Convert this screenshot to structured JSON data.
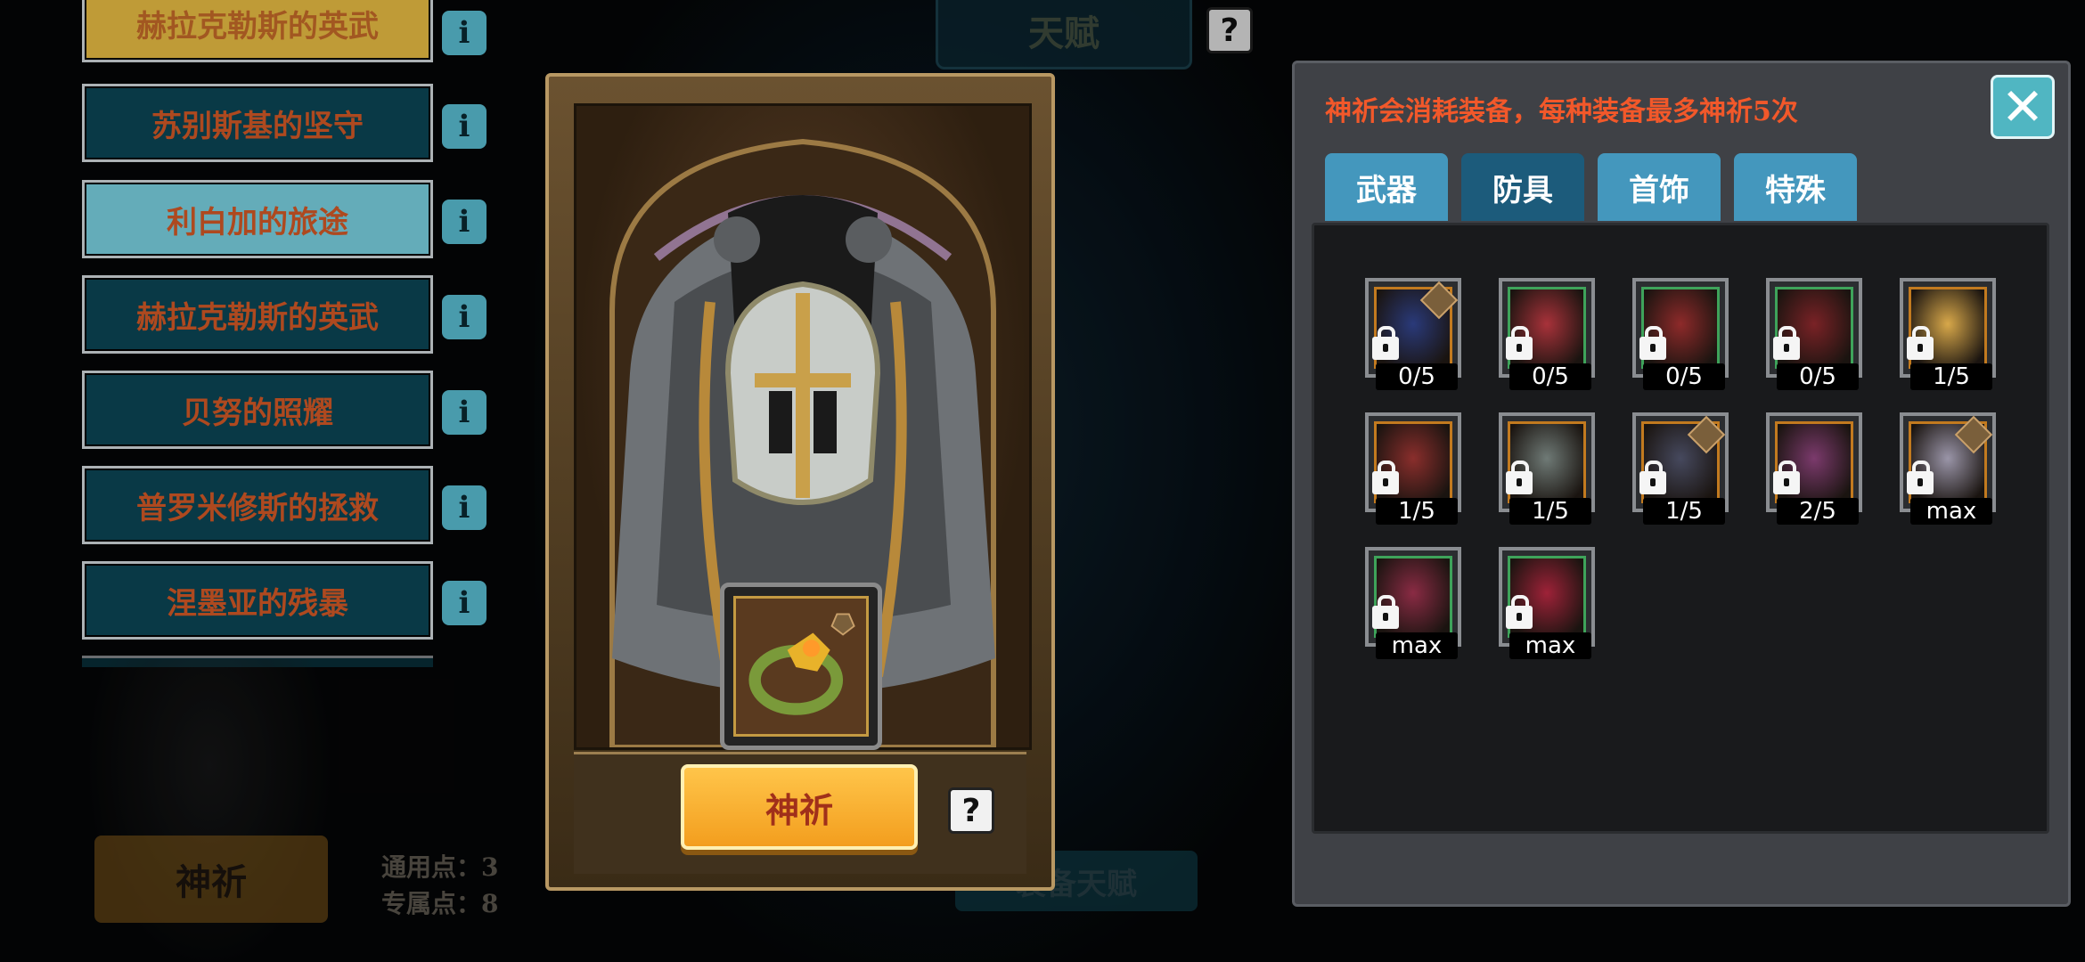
{
  "top_tab": {
    "label": "天赋"
  },
  "left_list": {
    "items": [
      {
        "label": "赫拉克勒斯的英武",
        "state": "gold-partial"
      },
      {
        "label": "苏别斯基的坚守",
        "state": "normal"
      },
      {
        "label": "利白加的旅途",
        "state": "selected"
      },
      {
        "label": "赫拉克勒斯的英武",
        "state": "normal"
      },
      {
        "label": "贝努的照耀",
        "state": "normal"
      },
      {
        "label": "普罗米修斯的拯救",
        "state": "normal"
      },
      {
        "label": "涅墨亚的残暴",
        "state": "normal"
      }
    ],
    "info_icon": "i"
  },
  "faded_bottom": {
    "pray_label": "神祈",
    "general_points": "通用点：3",
    "exclusive_points": "专属点：8",
    "talent_button": "装备天赋"
  },
  "card": {
    "pray_button": "神祈",
    "help_icon": "?"
  },
  "panel": {
    "notice": "神祈会消耗装备，每种装备最多神祈5次",
    "close_icon": "✕",
    "tabs": [
      {
        "label": "武器",
        "active": false
      },
      {
        "label": "防具",
        "active": true
      },
      {
        "label": "首饰",
        "active": false
      },
      {
        "label": "特殊",
        "active": false
      }
    ],
    "items": [
      {
        "count": "0/5",
        "frame": "orange",
        "tone": "#2a3a7a",
        "has_corner": true
      },
      {
        "count": "0/5",
        "frame": "green",
        "tone": "#a8323a",
        "has_corner": false
      },
      {
        "count": "0/5",
        "frame": "green",
        "tone": "#8e2a2a",
        "has_corner": false
      },
      {
        "count": "0/5",
        "frame": "green",
        "tone": "#7a2226",
        "has_corner": false
      },
      {
        "count": "1/5",
        "frame": "orange",
        "tone": "#d8a84a",
        "has_corner": false
      },
      {
        "count": "1/5",
        "frame": "orange",
        "tone": "#8a2e2c",
        "has_corner": false
      },
      {
        "count": "1/5",
        "frame": "orange",
        "tone": "#6f7a76",
        "has_corner": false
      },
      {
        "count": "1/5",
        "frame": "orange",
        "tone": "#46495e",
        "has_corner": true
      },
      {
        "count": "2/5",
        "frame": "orange",
        "tone": "#7b3a6c",
        "has_corner": false
      },
      {
        "count": "max",
        "frame": "orange",
        "tone": "#9a95a8",
        "has_corner": true
      },
      {
        "count": "max",
        "frame": "green",
        "tone": "#8a2b44",
        "has_corner": false
      },
      {
        "count": "max",
        "frame": "green",
        "tone": "#9e2238",
        "has_corner": false
      }
    ]
  },
  "colors": {
    "accent_orange": "#f39e1e",
    "list_bg": "#0c4d5e",
    "list_selected": "#86e6f7",
    "notice_red": "#f2582a",
    "tab_blue": "#4497bd",
    "tab_active": "#1c5b7b"
  }
}
